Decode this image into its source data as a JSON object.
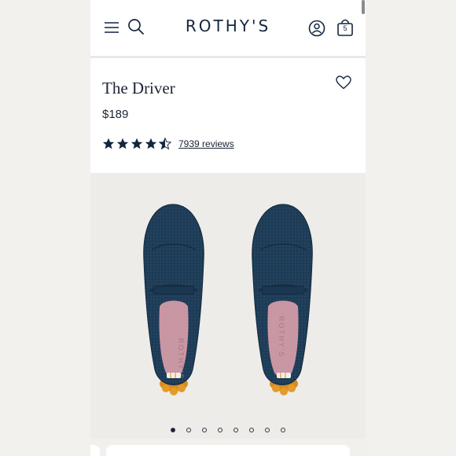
{
  "header": {
    "logo": "ROTHY'S",
    "bag_count": "5",
    "icons": [
      "hamburger-menu-icon",
      "search-icon",
      "account-icon",
      "shopping-bag-icon"
    ]
  },
  "product": {
    "title": "The Driver",
    "price": "$189",
    "rating_value": 4.5,
    "rating_max": 5,
    "reviews_label": "7939 reviews",
    "wishlist_icon": "heart-icon"
  },
  "gallery": {
    "image_description_icon": "shoe-pair-image",
    "slide_count": 8,
    "active_slide": 1,
    "insole_text": "ROTHY'S"
  },
  "colors": {
    "brand_navy": "#14253f",
    "shoe_navy": "#1d3b55",
    "insole_pink": "#c8909e",
    "gallery_bg": "#eeece8",
    "sole_orange": "#d98a1f"
  }
}
